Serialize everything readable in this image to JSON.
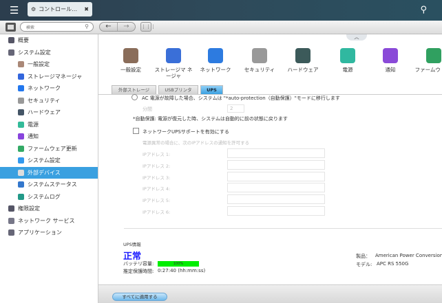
{
  "window": {
    "tab_title": "コントロール…",
    "search_placeholder": "検索"
  },
  "sidebar": {
    "items": [
      {
        "label": "概要",
        "level": 0,
        "icon": "overview-icon"
      },
      {
        "label": "システム設定",
        "level": 0,
        "icon": "gear-icon"
      },
      {
        "label": "一般設定",
        "level": 1,
        "icon": "general-settings-icon"
      },
      {
        "label": "ストレージマネージャ",
        "level": 1,
        "icon": "storage-icon"
      },
      {
        "label": "ネットワーク",
        "level": 1,
        "icon": "network-icon"
      },
      {
        "label": "セキュリティ",
        "level": 1,
        "icon": "lock-icon"
      },
      {
        "label": "ハードウェア",
        "level": 1,
        "icon": "hardware-icon"
      },
      {
        "label": "電源",
        "level": 1,
        "icon": "bulb-icon"
      },
      {
        "label": "通知",
        "level": 1,
        "icon": "notification-icon"
      },
      {
        "label": "ファームウェア更新",
        "level": 1,
        "icon": "firmware-icon"
      },
      {
        "label": "システム設定",
        "level": 1,
        "icon": "system-settings-icon"
      },
      {
        "label": "外部デバイス",
        "level": 1,
        "icon": "external-device-icon",
        "active": true
      },
      {
        "label": "システムステータス",
        "level": 1,
        "icon": "monitor-icon"
      },
      {
        "label": "システムログ",
        "level": 1,
        "icon": "log-icon"
      },
      {
        "label": "権限設定",
        "level": 0,
        "icon": "user-icon"
      },
      {
        "label": "ネットワーク サービス",
        "level": 0,
        "icon": "network-service-icon"
      },
      {
        "label": "アプリケーション",
        "level": 0,
        "icon": "application-icon"
      }
    ]
  },
  "icons": [
    {
      "label": "一般設定",
      "color": "#8a6d5a"
    },
    {
      "label": "ストレージマ ネージャ",
      "color": "#3a6fd8"
    },
    {
      "label": "ネットワーク",
      "color": "#2d7be0"
    },
    {
      "label": "セキュリティ",
      "color": "#999999"
    },
    {
      "label": "ハードウェア",
      "color": "#3c5a5a"
    },
    {
      "label": "電源",
      "color": "#30b8a0"
    },
    {
      "label": "通知",
      "color": "#8a4ad8"
    },
    {
      "label": "ファームウ 更新",
      "color": "#30a060"
    }
  ],
  "tabs": [
    "外部ストレージ",
    "USBプリンタ",
    "UPS"
  ],
  "ups": {
    "auto_protection": "AC 電源が故障した場合、システムは \"*auto-protection（自動保護）\"モードに移行します",
    "minutes_label": "分間",
    "minutes_value": "2",
    "note": "*自動保護: 電源が復元した時、システムは自動的に前の状態に戻ります",
    "network_ups": "ネットワークUPSサポートを有効にする",
    "allow_label": "電源異常の場合に、次のIPアドレスの通知を許可する",
    "ip_labels": [
      "IPアドレス 1:",
      "IPアドレス 2:",
      "IPアドレス 3:",
      "IPアドレス 4:",
      "IPアドレス 5:",
      "IPアドレス 6:"
    ],
    "info_title": "UPS情報",
    "status": "正常",
    "battery_label": "バッテリ容量:",
    "battery_percent": "100%",
    "battery_fraction": 1.0,
    "runtime_label": "推定保護時間:",
    "runtime": "0:27:40 (hh:mm:ss)",
    "product_label": "製品：",
    "product": "American Power Conversion",
    "model_label": "モデル:",
    "model": "APC RS 550G"
  },
  "apply_label": "すべてに適用する",
  "colors": {
    "accent": "#3aa0e0",
    "status": "#1a1aff",
    "battery": "#00ee00"
  }
}
